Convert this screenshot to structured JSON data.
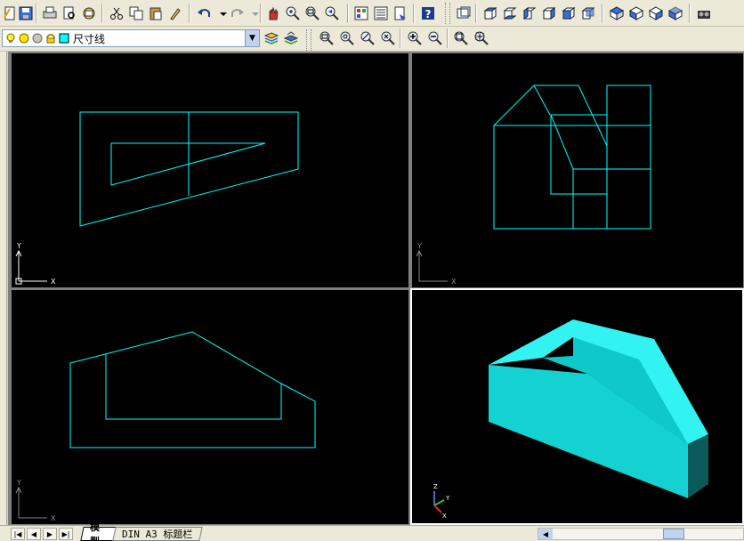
{
  "colors": {
    "wire": "#00ffff",
    "solid_top": "#33f2f2",
    "solid_front": "#14d2d2",
    "solid_side": "#0a5a5a",
    "viewport_bg": "#000000"
  },
  "toolbar_top": {
    "icons": [
      "new-icon",
      "save-icon",
      "print-icon",
      "print-preview-icon",
      "publish-icon",
      "cut-icon",
      "copy-icon",
      "paste-icon",
      "match-properties-icon",
      "undo-icon",
      "redo-icon",
      "pan-icon",
      "zoom-realtime-icon",
      "zoom-window-icon",
      "zoom-previous-icon",
      "properties-icon",
      "design-center-icon",
      "tool-palettes-icon",
      "help-icon",
      "named-views-icon",
      "top-view-icon",
      "bottom-view-icon",
      "left-view-icon",
      "right-view-icon",
      "front-view-icon",
      "back-view-icon",
      "sw-iso-icon",
      "se-iso-icon",
      "ne-iso-icon",
      "nw-iso-icon",
      "camera-icon"
    ]
  },
  "layer_toolbar": {
    "current_layer": "尺寸线",
    "icons": [
      "bulb-icon",
      "sun-icon",
      "lock-icon",
      "color-swatch-icon"
    ]
  },
  "zoom_toolbar": {
    "icons": [
      "zoom-window-icon",
      "zoom-dynamic-icon",
      "zoom-scale-icon",
      "zoom-center-icon",
      "zoom-in-icon",
      "zoom-out-icon",
      "zoom-all-icon",
      "zoom-extents-icon"
    ]
  },
  "tabs": {
    "model": "模型",
    "layout": "DIN A3 标题栏"
  },
  "ucs": {
    "x": "X",
    "y": "Y",
    "z": "Z"
  }
}
